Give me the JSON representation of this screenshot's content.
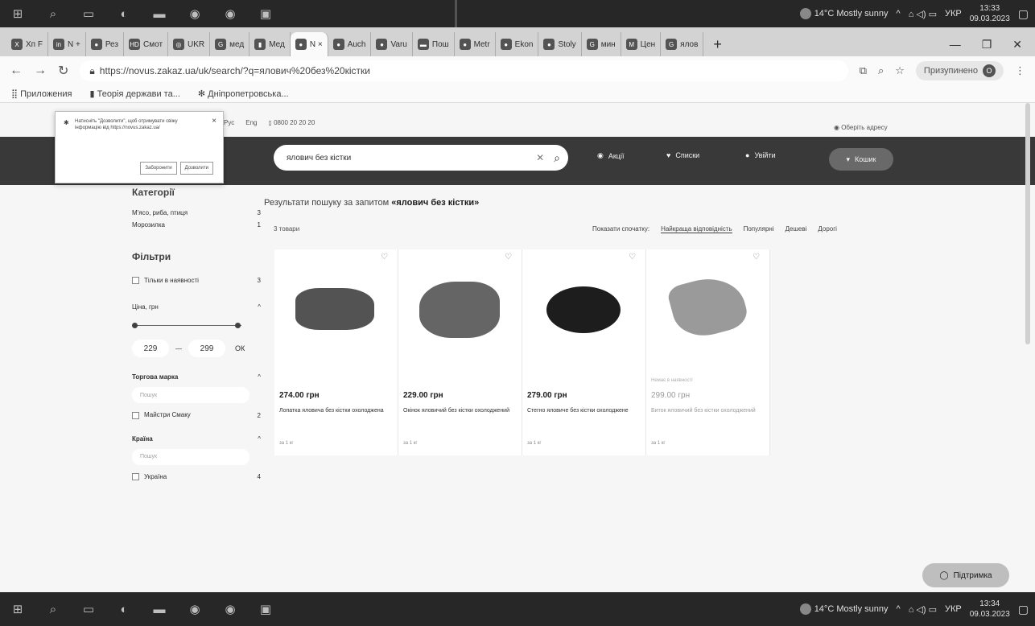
{
  "taskbar_top": {
    "weather": "14°C  Mostly sunny",
    "lang": "УКР",
    "time": "13:33",
    "date": "09.03.2023"
  },
  "taskbar_bottom": {
    "weather": "14°C  Mostly sunny",
    "lang": "УКР",
    "time": "13:34",
    "date": "09.03.2023"
  },
  "tabs": [
    {
      "icon": "X",
      "label": "Хп F"
    },
    {
      "icon": "in",
      "label": "N +"
    },
    {
      "icon": "●",
      "label": "Рез"
    },
    {
      "icon": "HD",
      "label": "Смот"
    },
    {
      "icon": "◎",
      "label": "UKR"
    },
    {
      "icon": "G",
      "label": "мед"
    },
    {
      "icon": "▮",
      "label": "Мед"
    },
    {
      "icon": "●",
      "label": "N ×",
      "active": true
    },
    {
      "icon": "●",
      "label": "Auch"
    },
    {
      "icon": "●",
      "label": "Varu"
    },
    {
      "icon": "▬",
      "label": "Пош"
    },
    {
      "icon": "●",
      "label": "Metr"
    },
    {
      "icon": "●",
      "label": "Ekon"
    },
    {
      "icon": "●",
      "label": "Stoly"
    },
    {
      "icon": "G",
      "label": "мин"
    },
    {
      "icon": "M",
      "label": "Цен"
    },
    {
      "icon": "G",
      "label": "ялов"
    }
  ],
  "address": {
    "url": "https://novus.zakaz.ua/uk/search/?q=ялович%20без%20кістки",
    "profile_status": "Призупинено",
    "profile_initial": "O"
  },
  "bookmarks": [
    "Приложения",
    "Теорія держави та...",
    "Дніпропетровська..."
  ],
  "util": {
    "lang1": "Рус",
    "lang2": "Eng",
    "phone": "0800 20 20 20",
    "choose_address": "Оберіть адресу"
  },
  "popup": {
    "message": "Натисніть \"Дозволити\", щоб отримувати свіжу інформацію від https://novus.zakaz.ua/",
    "deny": "Заборонити",
    "allow": "Дозволити"
  },
  "search": {
    "query": "ялович без кістки"
  },
  "header_nav": {
    "promos": "Акції",
    "lists": "Списки",
    "login": "Увійти",
    "cart": "Кошик"
  },
  "results": {
    "title_prefix": "Результати пошуку за запитом ",
    "title_query": "«ялович без кістки»",
    "count": "3 товари"
  },
  "sort": {
    "label": "Показати спочатку:",
    "options": [
      "Найкраща відповідність",
      "Популярні",
      "Дешеві",
      "Дорогі"
    ]
  },
  "sidebar": {
    "categories_title": "Категорії",
    "categories": [
      {
        "name": "М'ясо, риба, птиця",
        "count": "3"
      },
      {
        "name": "Морозилка",
        "count": "1"
      }
    ],
    "filters_title": "Фільтри",
    "in_stock": {
      "label": "Тільки в наявності",
      "count": "3"
    },
    "price": {
      "title": "Ціна, грн",
      "min": "229",
      "max": "299",
      "ok": "ОК"
    },
    "brand": {
      "title": "Торгова марка",
      "placeholder": "Пошук",
      "item": "Майстри Смаку",
      "count": "2"
    },
    "country": {
      "title": "Країна",
      "placeholder": "Пошук",
      "item": "Україна",
      "count": "4"
    }
  },
  "products": [
    {
      "price": "274.00 грн",
      "name": "Лопатка яловича без кістки охолоджена",
      "unit": "за 1 кг",
      "available": true
    },
    {
      "price": "229.00 грн",
      "name": "Окінок яловичий без кістки охолоджений",
      "unit": "за 1 кг",
      "available": true
    },
    {
      "price": "279.00 грн",
      "name": "Стегно яловиче без кістки охолоджене",
      "unit": "за 1 кг",
      "available": true
    },
    {
      "price": "299.00 грн",
      "name": "Биток яловичий без кістки охолоджений",
      "unit": "за 1 кг",
      "available": false,
      "availability_note": "Немає в наявності"
    }
  ],
  "support": "Підтримка"
}
